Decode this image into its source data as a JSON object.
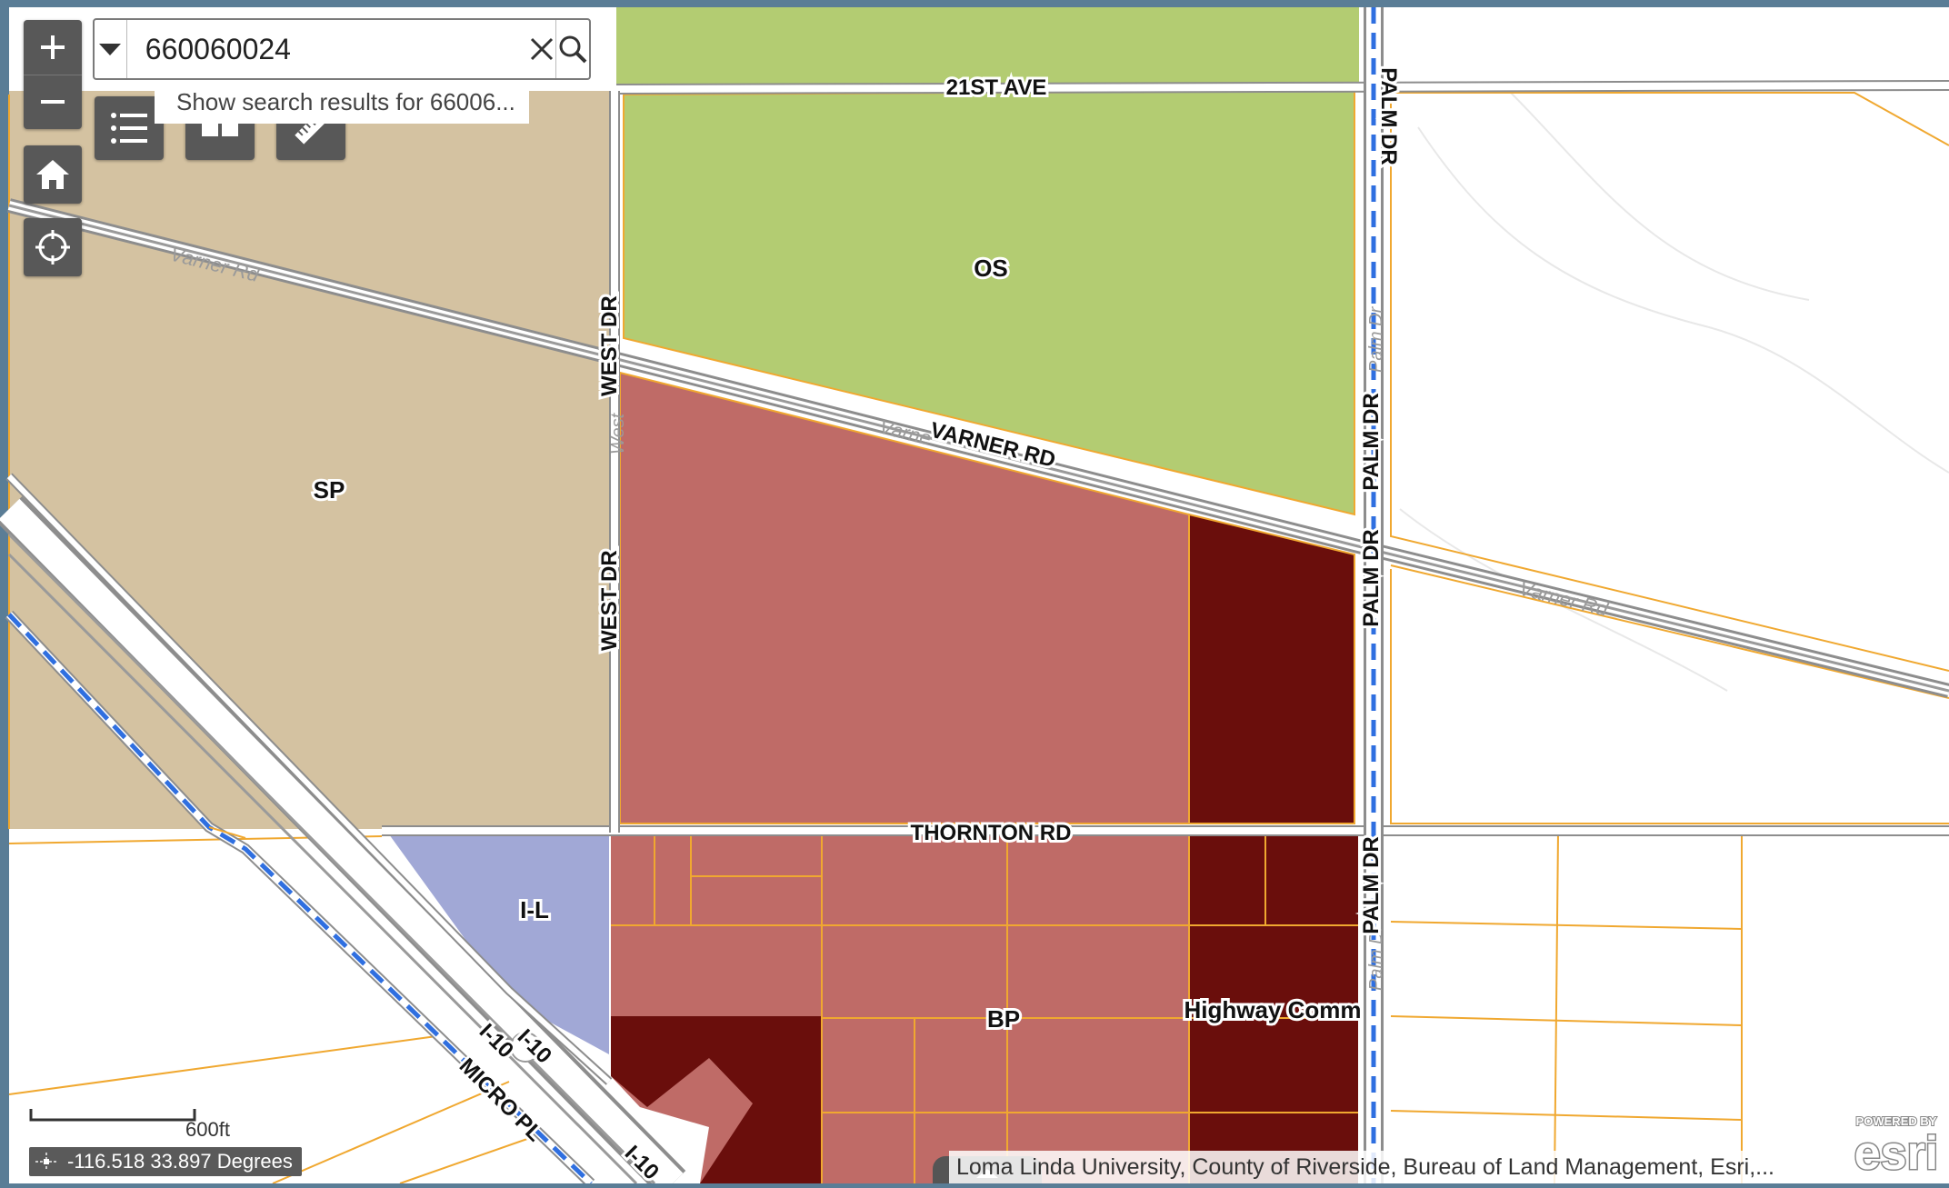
{
  "search": {
    "value": "660060024",
    "suggestion": "Show search results for 66006..."
  },
  "zoning_labels": {
    "os": "OS",
    "sp": "SP",
    "il": "I-L",
    "bp": "BP",
    "highway_comm": "Highway Comm"
  },
  "street_labels": {
    "ave_21st": "21ST AVE",
    "palm_dr": "PALM DR",
    "west_dr": "WEST DR",
    "varner_rd": "VARNER RD",
    "thornton_rd": "THORNTON RD",
    "i10": "I-10",
    "micro_pl": "MICRO PL"
  },
  "basemap_labels": {
    "varner_rd": "Varner Rd",
    "varner_rd_short": "Varne",
    "palm_dr": "Palm Dr",
    "west": "West"
  },
  "scale": {
    "label": "600ft"
  },
  "coordinates": {
    "text": "-116.518 33.897 Degrees"
  },
  "attribution": "Loma Linda University, County of Riverside, Bureau of Land Management, Esri,...",
  "esri": {
    "powered": "POWERED BY",
    "brand": "esri"
  },
  "colors": {
    "os": "#b3cc72",
    "sp": "#d4c2a1",
    "bp": "#bf6b67",
    "highway_comm": "#6a0e0c",
    "il": "#a1a8d6",
    "parcel_line": "#f0a830",
    "frame": "#5a7d96",
    "control": "#585858"
  },
  "icons": [
    "plus-icon",
    "minus-icon",
    "list-icon",
    "layout-icon",
    "ruler-icon",
    "home-icon",
    "locate-icon",
    "caret-down-icon",
    "close-icon",
    "search-icon"
  ]
}
